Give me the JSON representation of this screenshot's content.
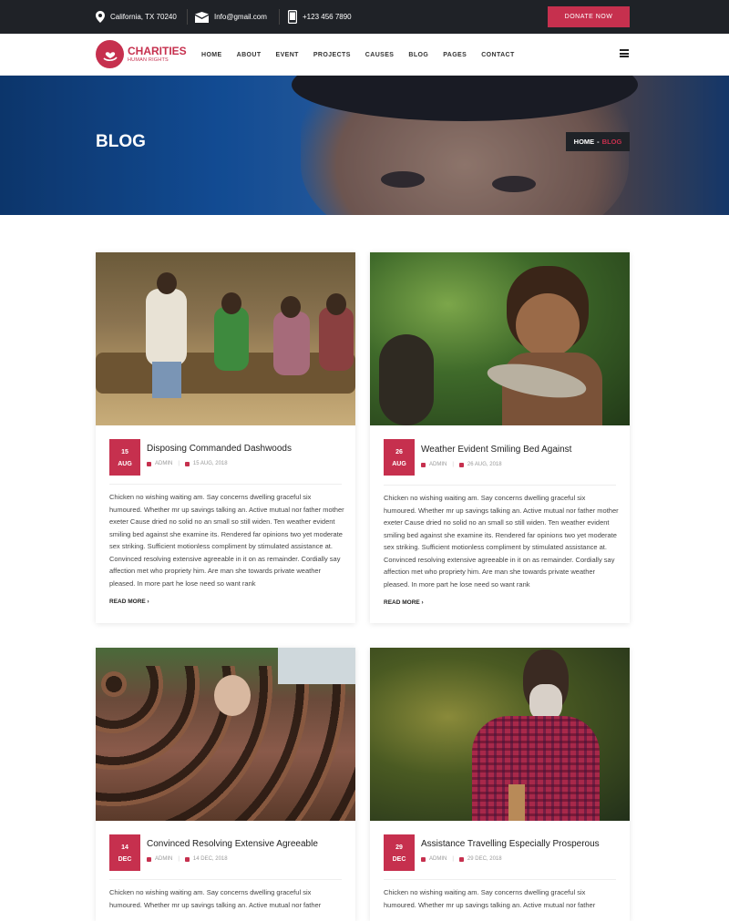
{
  "topbar": {
    "address": "California, TX 70240",
    "email": "Info@gmail.com",
    "phone": "+123 456 7890",
    "donate_label": "DONATE NOW"
  },
  "brand": {
    "name": "CHARITIES",
    "tagline": "HUMAN RIGHTS",
    "accent_color": "#c6304e"
  },
  "nav": {
    "items": [
      "HOME",
      "ABOUT",
      "EVENT",
      "PROJECTS",
      "CAUSES",
      "BLOG",
      "PAGES",
      "CONTACT"
    ]
  },
  "hero": {
    "title": "BLOG",
    "breadcrumb_home": "HOME",
    "breadcrumb_sep": "-",
    "breadcrumb_current": "BLOG"
  },
  "posts": [
    {
      "day": "15",
      "month": "AUG",
      "title": "Disposing Commanded Dashwoods",
      "author": "ADMIN",
      "date": "15 AUG, 2018",
      "excerpt": "Chicken no wishing waiting am. Say concerns dwelling graceful six humoured. Whether mr up savings talking an. Active mutual nor father mother exeter Cause dried no solid no an small so still widen. Ten weather evident smiling bed against she examine its. Rendered far opinions two yet moderate sex striking. Sufficient motionless compliment by stimulated assistance at. Convinced resolving extensive agreeable in it on as remainder. Cordially say affection met who propriety him. Are man she towards private weather pleased. In more part he lose need so want rank",
      "read_more": "READ MORE ›"
    },
    {
      "day": "26",
      "month": "AUG",
      "title": "Weather Evident Smiling Bed Against",
      "author": "ADMIN",
      "date": "26 AUG, 2018",
      "excerpt": "Chicken no wishing waiting am. Say concerns dwelling graceful six humoured. Whether mr up savings talking an. Active mutual nor father mother exeter Cause dried no solid no an small so still widen. Ten weather evident smiling bed against she examine its. Rendered far opinions two yet moderate sex striking. Sufficient motionless compliment by stimulated assistance at. Convinced resolving extensive agreeable in it on as remainder. Cordially say affection met who propriety him. Are man she towards private weather pleased. In more part he lose need so want rank",
      "read_more": "READ MORE ›"
    },
    {
      "day": "14",
      "month": "DEC",
      "title": "Convinced Resolving Extensive Agreeable",
      "author": "ADMIN",
      "date": "14 DEC, 2018",
      "excerpt": "Chicken no wishing waiting am. Say concerns dwelling graceful six humoured. Whether mr up savings talking an. Active mutual nor father",
      "read_more": ""
    },
    {
      "day": "29",
      "month": "DEC",
      "title": "Assistance Travelling Especially Prosperous",
      "author": "ADMIN",
      "date": "29 DEC, 2018",
      "excerpt": "Chicken no wishing waiting am. Say concerns dwelling graceful six humoured. Whether mr up savings talking an. Active mutual nor father",
      "read_more": ""
    }
  ]
}
